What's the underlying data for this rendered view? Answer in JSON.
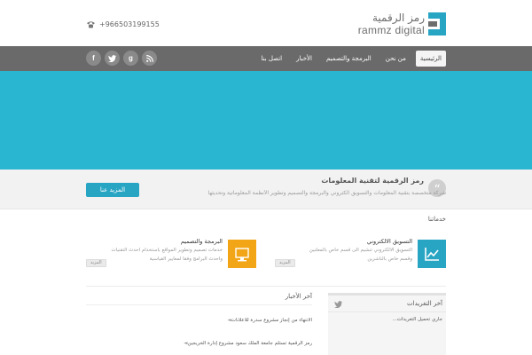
{
  "header": {
    "phone": "+966503199155",
    "logo_ar": "رمز الرقمية",
    "logo_en": "rammz digital"
  },
  "nav": {
    "items": [
      {
        "label": "الرئيسية",
        "active": true
      },
      {
        "label": "من نحن"
      },
      {
        "label": "البرمجة والتصميم"
      },
      {
        "label": "الأخبار"
      },
      {
        "label": "اتصل بنا"
      }
    ],
    "social": [
      {
        "icon": "facebook-icon",
        "glyph": "f"
      },
      {
        "icon": "twitter-icon",
        "glyph": "t"
      },
      {
        "icon": "google-plus-icon",
        "glyph": "g"
      },
      {
        "icon": "rss-icon",
        "glyph": "r"
      }
    ]
  },
  "colors": {
    "hero": "#29b6d0",
    "accent_button": "#29a5c4",
    "nav_bg": "#6a6a6a",
    "service_orange": "#f2a516",
    "service_blue": "#29a5c4"
  },
  "callout": {
    "title": "رمز الرقمية لتقنية المعلومات",
    "description": "شركة متخصصة بتقنية المعلومات والتسويق الكتروني والبرمجة والتصميم وتطوير الأنظمة المعلوماتية وتحديثها",
    "button": "المزيد عنا"
  },
  "services": {
    "heading": "خدماتنا",
    "items": [
      {
        "title": "التسويق الالكتروني",
        "desc_line1": "التسويق الالكتروني تنشيم الى قسم خاص بالمعلنين",
        "desc_line2": "وقسم خاص بالناشرين",
        "more": "المزيد",
        "icon": "chart-icon"
      },
      {
        "title": "البرمجة والتصميم",
        "desc_line1": "خدمات تصميم وتطوير المواقع باستخدام احدث التقنيات",
        "desc_line2": "واحدث البرامج وفقا لمعايير القياسية",
        "more": "المزيد",
        "icon": "monitor-icon"
      }
    ]
  },
  "news": {
    "heading": "آخر الأخبار",
    "items": [
      "الانتهاء من إنجاز مشروع سدرة للاعلانات",
      "رمز الرقمية تستلم جامعة الملك سعود مشروع إدارة الخريجين"
    ]
  },
  "tweets": {
    "heading": "آخر التغريدات",
    "text": "جاري تحميل التغريدات..."
  }
}
